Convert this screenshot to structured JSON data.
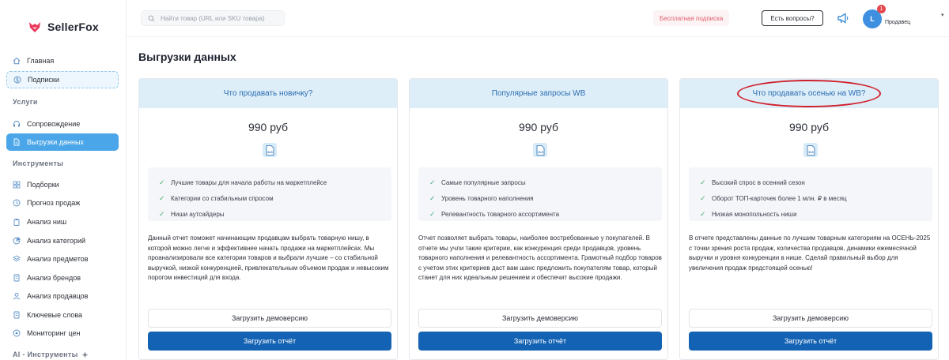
{
  "brand": {
    "name": "SellerFox",
    "logo_color": "#e8395a"
  },
  "sidebar": {
    "items_top": [
      {
        "label": "Главная",
        "icon": "home-icon"
      },
      {
        "label": "Подписки",
        "icon": "dollar-icon"
      }
    ],
    "section_services": "Услуги",
    "items_services": [
      {
        "label": "Сопровождение",
        "icon": "support-icon"
      },
      {
        "label": "Выгрузки данных",
        "icon": "file-icon"
      }
    ],
    "section_tools": "Инструменты",
    "items_tools": [
      {
        "label": "Подборки",
        "icon": "grid-icon"
      },
      {
        "label": "Прогноз продаж",
        "icon": "forecast-icon"
      },
      {
        "label": "Анализ ниш",
        "icon": "clipboard-icon"
      },
      {
        "label": "Анализ категорий",
        "icon": "pie-icon"
      },
      {
        "label": "Анализ предметов",
        "icon": "layers-icon"
      },
      {
        "label": "Анализ брендов",
        "icon": "doc-icon"
      },
      {
        "label": "Анализ продавцов",
        "icon": "user-icon"
      },
      {
        "label": "Ключевые слова",
        "icon": "doc-icon"
      },
      {
        "label": "Мониторинг цен",
        "icon": "monitor-icon"
      }
    ],
    "section_ai": "AI - Инструменты"
  },
  "topbar": {
    "search_placeholder": "Найти товар (URL или SKU товара)",
    "free_subscription": "Бесплатная подписка",
    "questions": "Есть вопросы?",
    "notifications_count": "1",
    "avatar_letter": "L",
    "user_role": "Продавец",
    "caret": "▾"
  },
  "main": {
    "title": "Выгрузки данных",
    "cards": [
      {
        "title": "Что продавать новичку?",
        "price": "990 руб",
        "features": [
          "Лучшие товары для начала работы на маркетплейсе",
          "Категории со стабильным спросом",
          "Ниши аутсайдеры"
        ],
        "description": "Данный отчет поможет начинающим продавцам выбрать товарную нишу, в которой можно легче и эффективнее начать продажи на маркетплейсах. Мы проанализировали все категории товаров и выбрали лучшие – со стабильной выручкой, низкой конкуренцией, привлекательным объемом продаж и невысоким порогом инвестиций для входа.",
        "demo_button": "Загрузить демоверсию",
        "report_button": "Загрузить отчёт"
      },
      {
        "title": "Популярные запросы WB",
        "price": "990 руб",
        "features": [
          "Самые популярные запросы",
          "Уровень товарного наполнения",
          "Релевантность товарного ассортимента"
        ],
        "description": "Отчет позволяет выбрать товары, наиболее востребованные у покупателей. В отчете мы учли такие критерии, как конкуренция среди продавцов, уровень товарного наполнения и релевантность ассортимента. Грамотный подбор товаров с учетом этих критериев даст вам шанс предложить покупателям товар, который станет для них идеальным решением и обеспечит высокие продажи.",
        "demo_button": "Загрузить демоверсию",
        "report_button": "Загрузить отчёт"
      },
      {
        "title": "Что продавать осенью на WB?",
        "price": "990 руб",
        "features": [
          "Высокий спрос в осенний сезон",
          "Оборот ТОП-карточек более 1 млн. ₽ в месяц",
          "Низкая монопольность ниши"
        ],
        "description": "В отчете представлены данные по лучшим товарным категориям на ОСЕНЬ-2025 с точки зрения роста продаж, количества продавцов, динамики ежемесячной выручки и уровня конкуренции в нише. Сделай правильный выбор для увеличения продаж предстоящей осенью!",
        "demo_button": "Загрузить демоверсию",
        "report_button": "Загрузить отчёт"
      }
    ]
  },
  "colors": {
    "accent": "#4aa6e8",
    "primary_button": "#1462b3",
    "card_header": "#deeef9",
    "highlight_circle": "#d0202b",
    "free_sub_text": "#e35d6a"
  }
}
